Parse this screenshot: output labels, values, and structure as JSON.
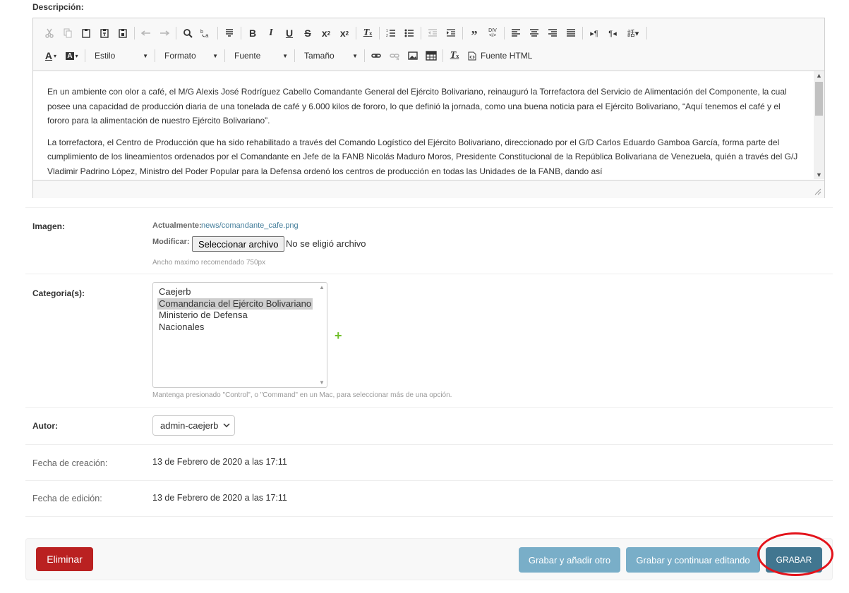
{
  "descripcion": {
    "label": "Descripción",
    "toolbar": {
      "estilo": "Estilo",
      "formato": "Formato",
      "fuente": "Fuente",
      "tamano": "Tamaño",
      "fuente_html": "Fuente HTML"
    },
    "paragraphs": [
      "En un ambiente con olor a café, el M/G Alexis José Rodríguez Cabello Comandante General del Ejército Bolivariano, reinauguró la Torrefactora del Servicio de Alimentación del Componente, la cual posee una capacidad de producción diaria de una tonelada de café y 6.000 kilos de fororo, lo que definió la jornada, como una buena noticia para el Ejército Bolivariano, “Aquí tenemos el café y el fororo para la alimentación de nuestro Ejército Bolivariano”.",
      "La torrefactora, el Centro de Producción que ha sido rehabilitado a través del Comando Logístico del Ejército Bolivariano, direccionado por el G/D Carlos Eduardo Gamboa García, forma parte del cumplimiento de los lineamientos ordenados por el Comandante en Jefe de la FANB Nicolás Maduro Moros, Presidente Constitucional de la República Bolivariana de Venezuela, quién a través del G/J Vladimir Padrino López, Ministro del Poder Popular para la Defensa ordenó los centros de producción en todas las Unidades de la FANB, dando así"
    ]
  },
  "imagen": {
    "label": "Imagen:",
    "current_label": "Actualmente:",
    "current_file": "news/comandante_cafe.png",
    "modify_label": "Modificar:",
    "select_button": "Seleccionar archivo",
    "no_file": "No se eligió archivo",
    "help": "Ancho maximo recomendado 750px"
  },
  "categorias": {
    "label": "Categoria(s):",
    "options": [
      "Caejerb",
      "Comandancia del Ejército Bolivariano",
      "Ministerio de Defensa",
      "Nacionales"
    ],
    "selected": "Comandancia del Ejército Bolivariano",
    "add_symbol": "+",
    "help": "Mantenga presionado \"Control\", o \"Command\" en un Mac, para seleccionar más de una opción."
  },
  "autor": {
    "label": "Autor:",
    "value": "admin-caejerb"
  },
  "fecha_creacion": {
    "label": "Fecha de creación:",
    "value": "13 de Febrero de 2020 a las 17:11"
  },
  "fecha_edicion": {
    "label": "Fecha de edición:",
    "value": "13 de Febrero de 2020 a las 17:11"
  },
  "actions": {
    "delete": "Eliminar",
    "save_add": "Grabar y añadir otro",
    "save_continue": "Grabar y continuar editando",
    "save": "GRABAR"
  },
  "colors": {
    "delete": "#ba2121",
    "secondary": "#79aec8",
    "primary": "#417690",
    "highlight_ring": "#e3131b"
  }
}
